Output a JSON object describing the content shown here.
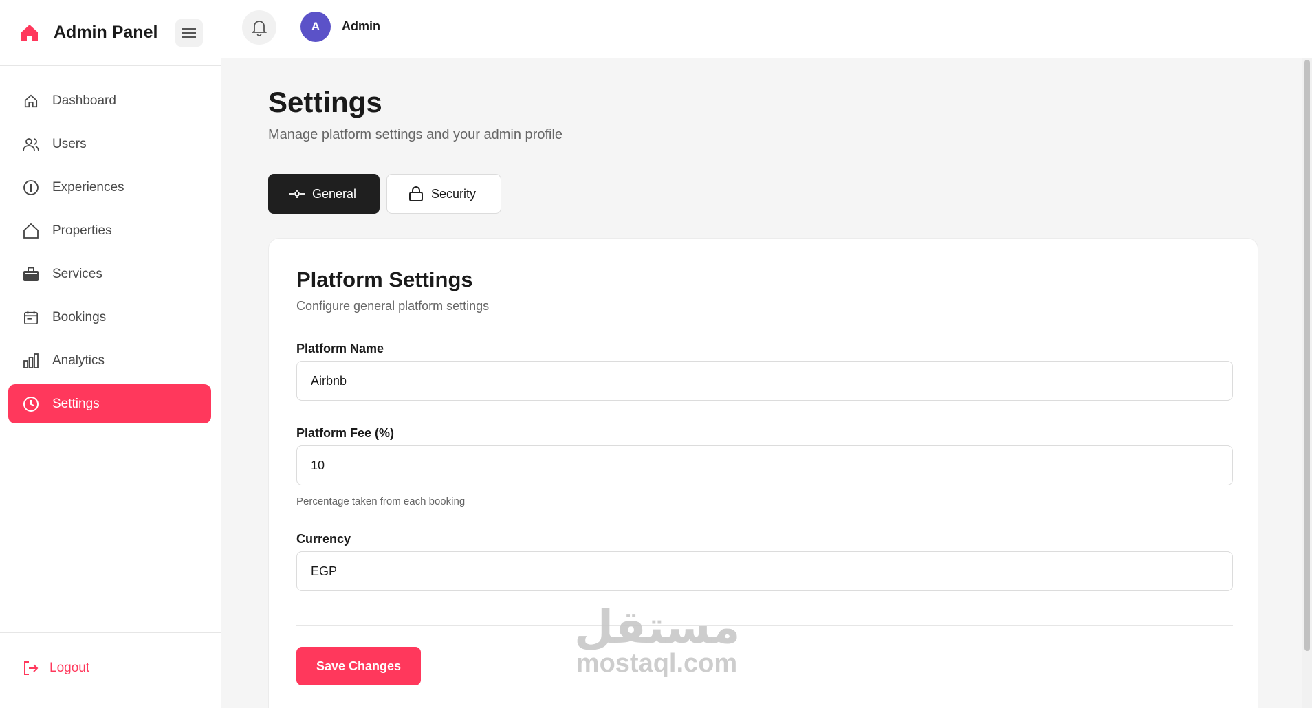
{
  "brand": {
    "title": "Admin Panel"
  },
  "sidebar": {
    "items": [
      {
        "label": "Dashboard",
        "icon": "home-icon"
      },
      {
        "label": "Users",
        "icon": "users-icon"
      },
      {
        "label": "Experiences",
        "icon": "compass-icon"
      },
      {
        "label": "Properties",
        "icon": "house-icon"
      },
      {
        "label": "Services",
        "icon": "briefcase-icon"
      },
      {
        "label": "Bookings",
        "icon": "calendar-icon"
      },
      {
        "label": "Analytics",
        "icon": "bar-chart-icon"
      },
      {
        "label": "Settings",
        "icon": "clock-icon",
        "active": true
      }
    ],
    "logout_label": "Logout"
  },
  "topbar": {
    "avatar_initial": "A",
    "user_name": "Admin"
  },
  "page": {
    "title": "Settings",
    "subtitle": "Manage platform settings and your admin profile"
  },
  "tabs": [
    {
      "label": "General",
      "icon": "general-icon",
      "active": true
    },
    {
      "label": "Security",
      "icon": "lock-icon",
      "active": false
    }
  ],
  "card": {
    "title": "Platform Settings",
    "subtitle": "Configure general platform settings",
    "fields": {
      "platform_name": {
        "label": "Platform Name",
        "value": "Airbnb"
      },
      "platform_fee": {
        "label": "Platform Fee (%)",
        "value": "10",
        "help": "Percentage taken from each booking"
      },
      "currency": {
        "label": "Currency",
        "value": "EGP"
      }
    },
    "save_label": "Save Changes"
  },
  "watermark": {
    "arabic": "مستقل",
    "latin": "mostaql.com"
  },
  "colors": {
    "accent": "#ff385c",
    "dark": "#1f1f1f",
    "avatar": "#5b52c8"
  }
}
